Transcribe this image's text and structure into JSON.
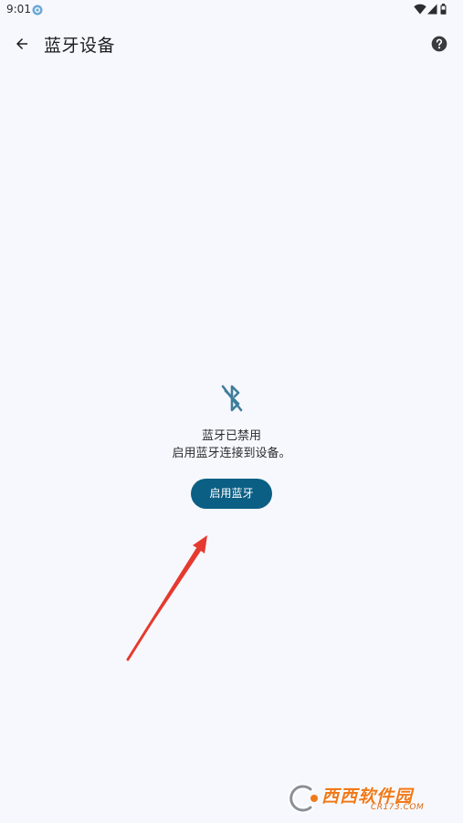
{
  "status_bar": {
    "time": "9:01",
    "icons": [
      "app-notification-icon",
      "wifi-icon",
      "signal-icon",
      "battery-icon"
    ]
  },
  "app_bar": {
    "title": "蓝牙设备",
    "back_icon": "arrow-back-icon",
    "help_icon": "help-circle-icon"
  },
  "empty_state": {
    "icon": "bluetooth-disabled-icon",
    "title": "蓝牙已禁用",
    "subtitle": "启用蓝牙连接到设备。",
    "button_label": "启用蓝牙"
  },
  "watermark": {
    "brand": "西西软件园",
    "site": "CR173.COM"
  },
  "colors": {
    "background": "#f7f8fd",
    "accent": "#0b5f85",
    "icon_tint": "#3e7d9c",
    "annotation_arrow": "#e53a2f"
  }
}
